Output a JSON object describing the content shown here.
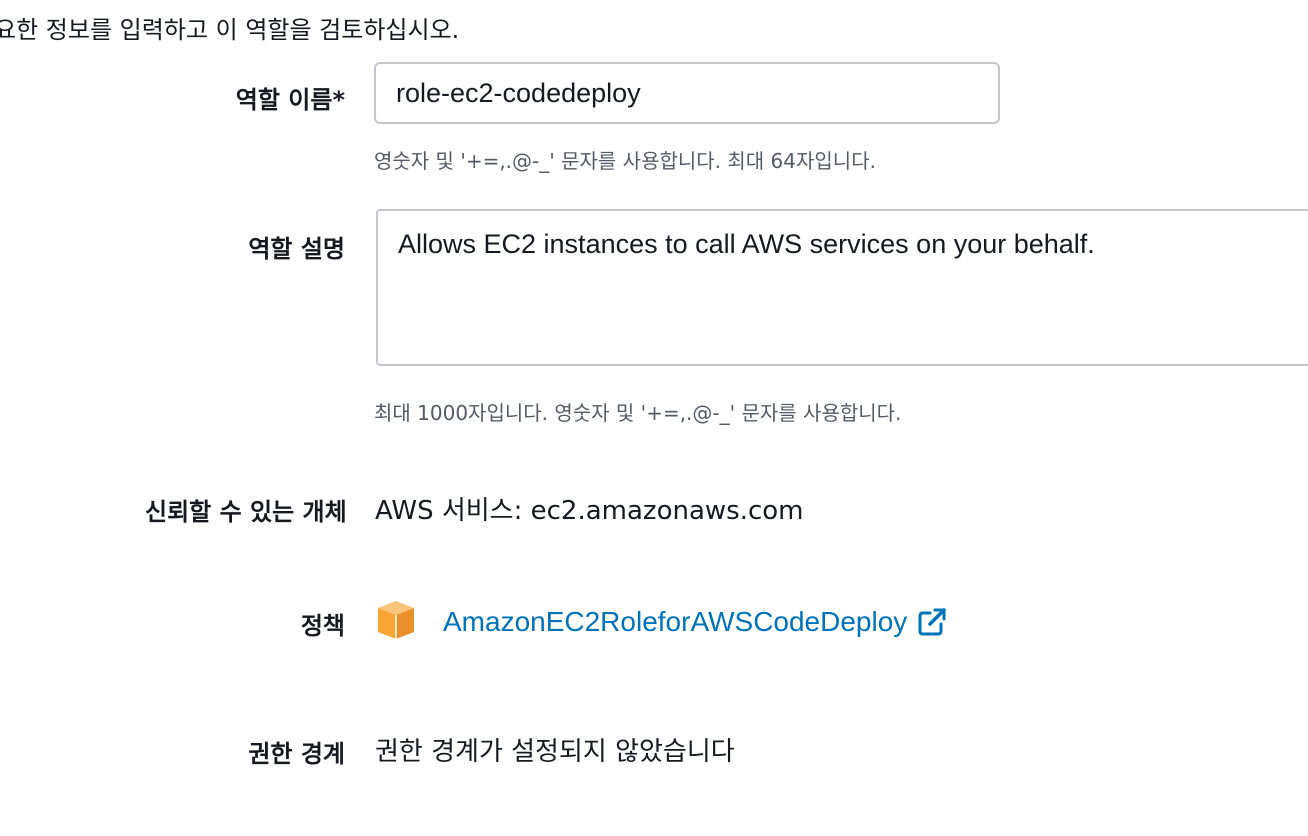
{
  "intro_text": "요한 정보를 입력하고 이 역할을 검토하십시오.",
  "role_name": {
    "label": "역할 이름*",
    "value": "role-ec2-codedeploy",
    "hint": "영숫자 및 '+=,.@-_' 문자를 사용합니다. 최대 64자입니다."
  },
  "role_description": {
    "label": "역할 설명",
    "value": "Allows EC2 instances to call AWS services on your behalf.",
    "hint": "최대 1000자입니다. 영숫자 및 '+=,.@-_' 문자를 사용합니다."
  },
  "trusted_entity": {
    "label": "신뢰할 수 있는 개체",
    "value": "AWS 서비스: ec2.amazonaws.com"
  },
  "policy": {
    "label": "정책",
    "icon": "policy-cube-icon",
    "link_text": "AmazonEC2RoleforAWSCodeDeploy",
    "link_icon": "external-link-icon",
    "icon_color": "#f7a534",
    "link_color": "#0073bb"
  },
  "permissions_boundary": {
    "label": "권한 경계",
    "value": "권한 경계가 설정되지 않았습니다"
  }
}
